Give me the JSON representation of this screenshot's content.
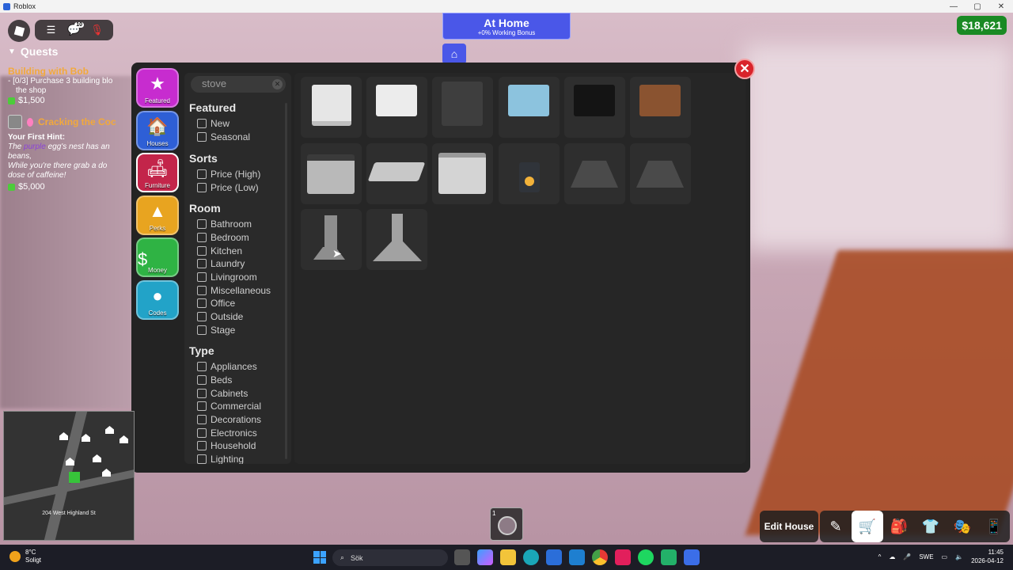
{
  "window": {
    "title": "Roblox",
    "controls": [
      "—",
      "▢",
      "✕"
    ]
  },
  "topbar": {
    "roblox_icon": "roblox-logo",
    "menu_icon": "☰",
    "chat_badge": "10",
    "mic_icon": "🎙"
  },
  "quests": {
    "header": "Quests",
    "quest1_title": "Building with Bob",
    "quest1_task": "[0/3] Purchase 3 building blo",
    "quest1_task2": "the shop",
    "quest1_reward": "$1,500",
    "quest2_title": "Cracking the Coc",
    "hint_label": "Your First Hint:",
    "hint_line1_a": "The ",
    "hint_line1_b": "purple",
    "hint_line1_c": " egg's nest has an",
    "hint_line2": "beans,",
    "hint_line3": "While you're there grab a do",
    "hint_line4": "dose of caffeine!",
    "quest2_reward": "$5,000"
  },
  "banner": {
    "title": "At Home",
    "subtitle": "+0% Working Bonus",
    "home_icon": "home-icon"
  },
  "cash": "$18,621",
  "categories": [
    {
      "label": "Featured",
      "icon": "★"
    },
    {
      "label": "Houses",
      "icon": "🏠"
    },
    {
      "label": "Furniture",
      "icon": "🛋"
    },
    {
      "label": "Perks",
      "icon": "▲"
    },
    {
      "label": "Money",
      "icon": "$"
    },
    {
      "label": "Codes",
      "icon": "●"
    }
  ],
  "search": {
    "value": "stove",
    "clear": "✕"
  },
  "filters": {
    "featured": {
      "title": "Featured",
      "options": [
        "New",
        "Seasonal"
      ]
    },
    "sorts": {
      "title": "Sorts",
      "options": [
        "Price (High)",
        "Price (Low)"
      ]
    },
    "room": {
      "title": "Room",
      "options": [
        "Bathroom",
        "Bedroom",
        "Kitchen",
        "Laundry",
        "Livingroom",
        "Miscellaneous",
        "Office",
        "Outside",
        "Stage"
      ]
    },
    "type": {
      "title": "Type",
      "options": [
        "Appliances",
        "Beds",
        "Cabinets",
        "Commercial",
        "Decorations",
        "Electronics",
        "Household",
        "Lighting"
      ]
    }
  },
  "items": [
    {
      "name": "white-cabinet-1",
      "color": "#e6e6e6"
    },
    {
      "name": "white-cabinet-2",
      "color": "#ececec"
    },
    {
      "name": "gray-cabinet",
      "color": "#3e3e3e"
    },
    {
      "name": "blue-cabinet",
      "color": "#8cc3de"
    },
    {
      "name": "black-cabinet",
      "color": "#141414"
    },
    {
      "name": "wood-cabinet",
      "color": "#8a5330"
    },
    {
      "name": "stove-1",
      "color": "#b9b9b9"
    },
    {
      "name": "cooktop",
      "color": "#c8c8c8"
    },
    {
      "name": "stove-2",
      "color": "#d4d4d4"
    },
    {
      "name": "wood-stove",
      "color": "#30343a"
    },
    {
      "name": "range-hood-1",
      "color": "#4a4a4a"
    },
    {
      "name": "range-hood-2",
      "color": "#4a4a4a"
    },
    {
      "name": "chimney-hood-1",
      "color": "#8e8e8e"
    },
    {
      "name": "chimney-hood-2",
      "color": "#a2a2a2"
    }
  ],
  "minimap": {
    "address": "204 West Highland St"
  },
  "hotbar": {
    "slot1_number": "1"
  },
  "bottom_right": {
    "edit_house": "Edit House"
  },
  "taskbar": {
    "temp": "8°C",
    "weather": "Soligt",
    "search_placeholder": "Sök",
    "lang": "SWE",
    "time": "11:45",
    "date": "2026-04-12"
  }
}
